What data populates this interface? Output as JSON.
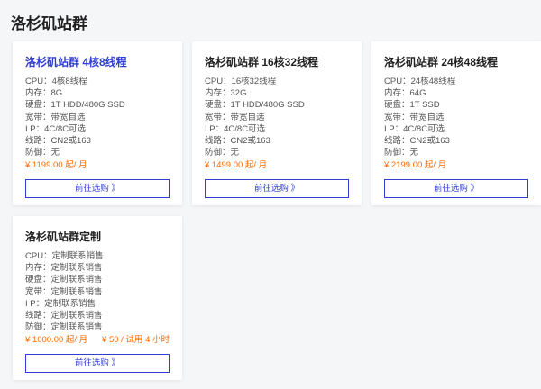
{
  "page": {
    "title": "洛杉矶站群"
  },
  "cards": [
    {
      "title": "洛杉矶站群 4核8线程",
      "specs": [
        {
          "k": "CPU：",
          "v": "4核8线程"
        },
        {
          "k": "内存：",
          "v": "8G"
        },
        {
          "k": "硬盘：",
          "v": "1T HDD/480G SSD"
        },
        {
          "k": "宽带：",
          "v": "带宽自选"
        },
        {
          "k": "I P：",
          "v": "4C/8C可选"
        },
        {
          "k": "线路：",
          "v": "CN2或163"
        },
        {
          "k": "防御：",
          "v": "无"
        }
      ],
      "price": "¥ 1199.00 起/ 月",
      "trial": "",
      "button": "前往选购 》"
    },
    {
      "title": "洛杉矶站群 16核32线程",
      "specs": [
        {
          "k": "CPU：",
          "v": "16核32线程"
        },
        {
          "k": "内存：",
          "v": "32G"
        },
        {
          "k": "硬盘：",
          "v": "1T HDD/480G SSD"
        },
        {
          "k": "宽带：",
          "v": "带宽自选"
        },
        {
          "k": "I P：",
          "v": "4C/8C可选"
        },
        {
          "k": "线路：",
          "v": "CN2或163"
        },
        {
          "k": "防御：",
          "v": "无"
        }
      ],
      "price": "¥ 1499.00 起/ 月",
      "trial": "",
      "button": "前往选购 》"
    },
    {
      "title": "洛杉矶站群 24核48线程",
      "specs": [
        {
          "k": "CPU：",
          "v": "24核48线程"
        },
        {
          "k": "内存：",
          "v": "64G"
        },
        {
          "k": "硬盘：",
          "v": "1T SSD"
        },
        {
          "k": "宽带：",
          "v": "带宽自选"
        },
        {
          "k": "I P：",
          "v": "4C/8C可选"
        },
        {
          "k": "线路：",
          "v": "CN2或163"
        },
        {
          "k": "防御：",
          "v": "无"
        }
      ],
      "price": "¥ 2199.00 起/ 月",
      "trial": "",
      "button": "前往选购 》"
    },
    {
      "title": "洛杉矶站群定制",
      "specs": [
        {
          "k": "CPU：",
          "v": "定制联系销售"
        },
        {
          "k": "内存：",
          "v": "定制联系销售"
        },
        {
          "k": "硬盘：",
          "v": "定制联系销售"
        },
        {
          "k": "宽带：",
          "v": "定制联系销售"
        },
        {
          "k": "I P：",
          "v": "定制联系销售"
        },
        {
          "k": "线路：",
          "v": "定制联系销售"
        },
        {
          "k": "防御：",
          "v": "定制联系销售"
        }
      ],
      "price": "¥ 1000.00 起/ 月",
      "trial": "¥ 50 / 试用 4 小时",
      "button": "前往选购 》"
    }
  ],
  "colors": {
    "accent": "#2f3ed1",
    "price": "#ff6a00"
  }
}
